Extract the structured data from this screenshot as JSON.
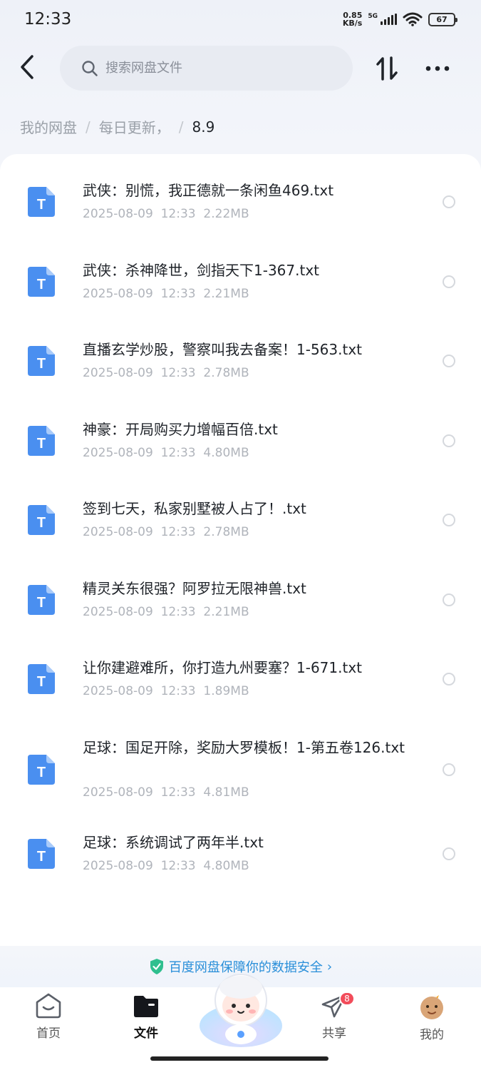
{
  "status_bar": {
    "time": "12:33",
    "net_speed_value": "0.85",
    "net_speed_unit": "KB/s",
    "network": "5G",
    "battery": "67"
  },
  "search": {
    "placeholder": "搜索网盘文件"
  },
  "breadcrumb": {
    "root": "我的网盘",
    "middle": "每日更新，",
    "current": "8.9"
  },
  "files": [
    {
      "name": "武侠：别慌，我正德就一条闲鱼469.txt",
      "date": "2025-08-09",
      "time": "12:33",
      "size": "2.22MB"
    },
    {
      "name": "武侠：杀神降世，剑指天下1-367.txt",
      "date": "2025-08-09",
      "time": "12:33",
      "size": "2.21MB"
    },
    {
      "name": "直播玄学炒股，警察叫我去备案！1-563.txt",
      "date": "2025-08-09",
      "time": "12:33",
      "size": "2.78MB"
    },
    {
      "name": "神豪：开局购买力增幅百倍.txt",
      "date": "2025-08-09",
      "time": "12:33",
      "size": "4.80MB"
    },
    {
      "name": "签到七天，私家别墅被人占了！.txt",
      "date": "2025-08-09",
      "time": "12:33",
      "size": "2.78MB"
    },
    {
      "name": "精灵关东很强？阿罗拉无限神兽.txt",
      "date": "2025-08-09",
      "time": "12:33",
      "size": "2.21MB"
    },
    {
      "name": "让你建避难所，你打造九州要塞？1-671.txt",
      "date": "2025-08-09",
      "time": "12:33",
      "size": "1.89MB"
    },
    {
      "name": "足球：国足开除，奖励大罗模板！1-第五卷126.txt",
      "date": "2025-08-09",
      "time": "12:33",
      "size": "4.81MB"
    },
    {
      "name": "足球：系统调试了两年半.txt",
      "date": "2025-08-09",
      "time": "12:33",
      "size": "4.80MB"
    }
  ],
  "file_icon_letter": "T",
  "security_notice": "百度网盘保障你的数据安全",
  "bottom_nav": {
    "home": "首页",
    "files": "文件",
    "share": "共享",
    "share_badge": "8",
    "mine": "我的"
  },
  "colors": {
    "accent_blue": "#4a8ff0",
    "security_text": "#2a8fd9",
    "badge_red": "#f24c5a"
  }
}
